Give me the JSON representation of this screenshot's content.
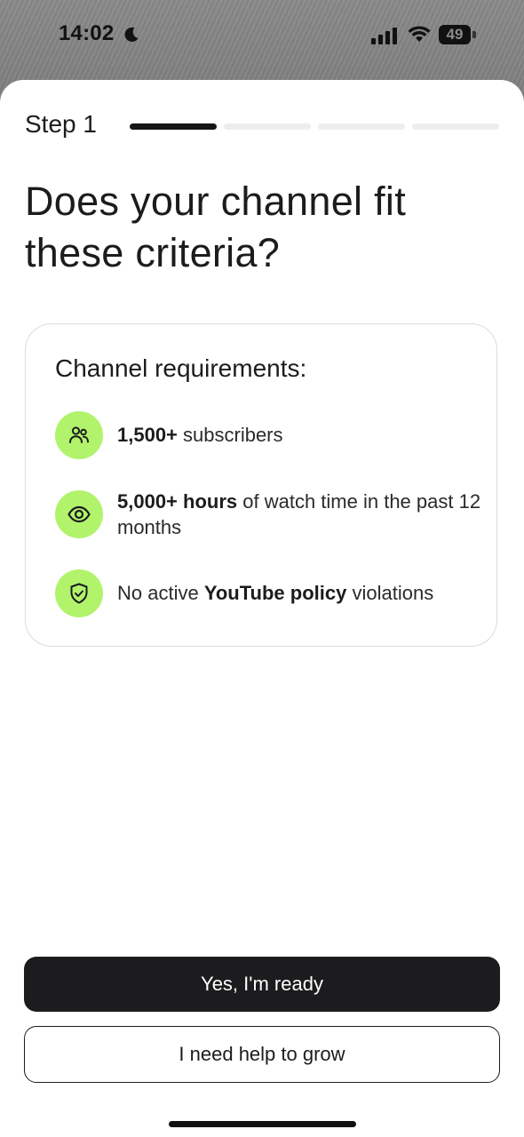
{
  "status_bar": {
    "time": "14:02",
    "battery": "49",
    "icons": [
      "moon-icon",
      "signal-icon",
      "wifi-icon",
      "battery-icon"
    ]
  },
  "step": {
    "label": "Step 1",
    "current": 1,
    "total": 4
  },
  "title": "Does your channel fit these criteria?",
  "card": {
    "title": "Channel requirements:",
    "items": [
      {
        "icon": "users-icon",
        "bold": "1,500+",
        "rest": " subscribers"
      },
      {
        "icon": "eye-icon",
        "bold": "5,000+ hours",
        "rest": " of watch time in the past 12 months"
      },
      {
        "icon": "shield-check-icon",
        "prefix": "No active ",
        "bold": "YouTube policy",
        "rest": " violations"
      }
    ]
  },
  "buttons": {
    "primary": "Yes, I'm ready",
    "secondary": "I need help to grow"
  },
  "colors": {
    "accent": "#b2f36c",
    "dark": "#1c1c1e",
    "progress_inactive": "#eeeeee"
  }
}
